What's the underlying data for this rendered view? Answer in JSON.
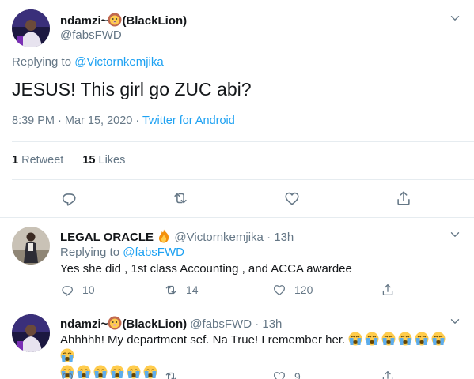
{
  "main_tweet": {
    "display_name": "ndamzi~",
    "display_suffix": "(BlackLion)",
    "handle": "@fabsFWD",
    "replying_prefix": "Replying to",
    "replying_to": "@Victornkemjika",
    "text": "JESUS! This girl go ZUC abi?",
    "timestamp": "8:39 PM · Mar 15, 2020",
    "source_sep": "·",
    "source": "Twitter for Android",
    "retweets_count": "1",
    "retweets_label": "Retweet",
    "likes_count": "15",
    "likes_label": "Likes"
  },
  "replies": [
    {
      "display_name": "LEGAL ORACLE",
      "handle": "@Victornkemjika",
      "time": "· 13h",
      "replying_prefix": "Replying to",
      "replying_to": "@fabsFWD",
      "text": "Yes she did , 1st class Accounting , and ACCA awardee",
      "replies_count": "10",
      "retweets_count": "14",
      "likes_count": "120"
    },
    {
      "display_name": "ndamzi~",
      "display_suffix": "(BlackLion)",
      "handle": "@fabsFWD",
      "time": "· 13h",
      "text": "Ahhhhh! My department sef. Na True! I remember her.",
      "likes_count": "9"
    }
  ],
  "colors": {
    "link": "#1da1f2",
    "muted": "#657786",
    "divider": "#e6ecf0"
  },
  "icons": [
    "lion-face-icon",
    "fire-icon",
    "loudly-crying-face-icon",
    "chevron-down-icon",
    "reply-icon",
    "retweet-icon",
    "like-icon",
    "share-icon"
  ]
}
